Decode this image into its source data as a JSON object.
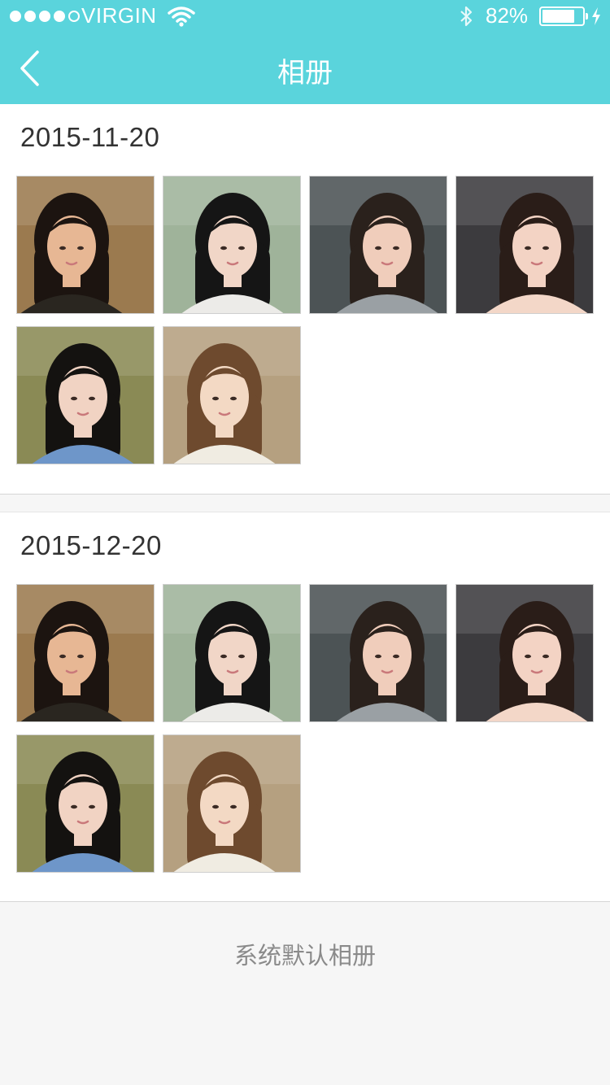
{
  "status_bar": {
    "carrier": "VIRGIN",
    "signal_bars": 5,
    "signal_filled": 4,
    "battery_text": "82%",
    "battery_level": 0.82
  },
  "nav": {
    "title": "相册",
    "back_icon": "chevron-left-icon"
  },
  "albums": [
    {
      "date": "2015-11-20",
      "photos": [
        {
          "name": "photo-sunlit-portrait",
          "bg": "#9b7a4f",
          "hair": "#1c1410",
          "skin": "#e7b794",
          "cloth": "#2a2620"
        },
        {
          "name": "photo-garden-portrait",
          "bg": "#9fb39a",
          "hair": "#151515",
          "skin": "#f1d6c7",
          "cloth": "#ecebe8"
        },
        {
          "name": "photo-bob-hair-portrait",
          "bg": "#4c5355",
          "hair": "#2a211c",
          "skin": "#f0cdbb",
          "cloth": "#9aa0a4"
        },
        {
          "name": "photo-balcony-portrait",
          "bg": "#3c3b3e",
          "hair": "#2a1d18",
          "skin": "#f3d3c4",
          "cloth": "#f3d7c8"
        },
        {
          "name": "photo-field-portrait",
          "bg": "#8a8a55",
          "hair": "#141210",
          "skin": "#f1d3c3",
          "cloth": "#6e96c9"
        },
        {
          "name": "photo-flower-portrait",
          "bg": "#b5a080",
          "hair": "#6e4a2e",
          "skin": "#f3d9c4",
          "cloth": "#f0ece2"
        }
      ]
    },
    {
      "date": "2015-12-20",
      "photos": [
        {
          "name": "photo-sunlit-portrait",
          "bg": "#9b7a4f",
          "hair": "#1c1410",
          "skin": "#e7b794",
          "cloth": "#2a2620"
        },
        {
          "name": "photo-garden-portrait",
          "bg": "#9fb39a",
          "hair": "#151515",
          "skin": "#f1d6c7",
          "cloth": "#ecebe8"
        },
        {
          "name": "photo-bob-hair-portrait",
          "bg": "#4c5355",
          "hair": "#2a211c",
          "skin": "#f0cdbb",
          "cloth": "#9aa0a4"
        },
        {
          "name": "photo-balcony-portrait",
          "bg": "#3c3b3e",
          "hair": "#2a1d18",
          "skin": "#f3d3c4",
          "cloth": "#f3d7c8"
        },
        {
          "name": "photo-field-portrait",
          "bg": "#8a8a55",
          "hair": "#141210",
          "skin": "#f1d3c3",
          "cloth": "#6e96c9"
        },
        {
          "name": "photo-flower-portrait",
          "bg": "#b5a080",
          "hair": "#6e4a2e",
          "skin": "#f3d9c4",
          "cloth": "#f0ece2"
        }
      ]
    }
  ],
  "footer": {
    "default_album_label": "系统默认相册"
  },
  "colors": {
    "header_bg": "#5ad4dc",
    "page_bg": "#f6f6f6",
    "footer_text": "#8a8a8a"
  }
}
